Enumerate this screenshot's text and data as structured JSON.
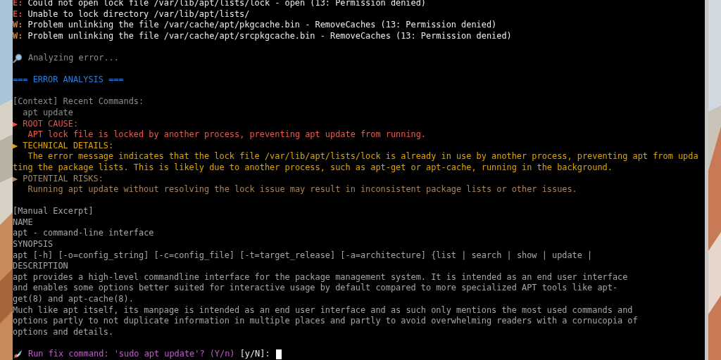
{
  "terminal": {
    "lines": [
      {
        "kind": "error",
        "prefix": "E:",
        "text": "Could not open lock file /var/lib/apt/lists/lock - open (13: Permission denied)"
      },
      {
        "kind": "error",
        "prefix": "E:",
        "text": "Unable to lock directory /var/lib/apt/lists/"
      },
      {
        "kind": "warning",
        "prefix": "W:",
        "text": "Problem unlinking the file /var/cache/apt/pkgcache.bin - RemoveCaches (13: Permission denied)"
      },
      {
        "kind": "warning",
        "prefix": "W:",
        "text": "Problem unlinking the file /var/cache/apt/srcpkgcache.bin - RemoveCaches (13: Permission denied)"
      },
      {
        "kind": "status",
        "text": "Analyzing error...",
        "space_before": true
      },
      {
        "kind": "heading",
        "text": "=== ERROR ANALYSIS ===",
        "space_before": true
      },
      {
        "kind": "note",
        "text": "[Context] Recent Commands:",
        "space_before": true
      },
      {
        "kind": "command",
        "text": "apt update"
      },
      {
        "kind": "cause",
        "prefix": "▶",
        "text": "ROOT CAUSE:"
      },
      {
        "kind": "cause_detail",
        "text": "APT lock file is locked by another process, preventing apt update from running."
      },
      {
        "kind": "tech",
        "prefix": "▶",
        "text": "TECHNICAL DETAILS:"
      },
      {
        "kind": "tech_detail",
        "text": "The error message indicates that the lock file /var/lib/apt/lists/lock is already in use by another process, preventing apt from upda"
      },
      {
        "kind": "tech_wrap",
        "text": "ting the package lists. This is likely due to another process, such as apt-get or apt-cache, running in the background."
      },
      {
        "kind": "risk",
        "prefix": "▶",
        "text": "POTENTIAL RISKS:"
      },
      {
        "kind": "risk_detail",
        "text": "Running apt update without resolving the lock issue may result in inconsistent package lists or other issues."
      },
      {
        "kind": "manual",
        "text": "[Manual Excerpt]",
        "space_before": true
      },
      {
        "kind": "manual",
        "text": "NAME"
      },
      {
        "kind": "manual",
        "text": "apt - command-line interface"
      },
      {
        "kind": "manual",
        "text": "SYNOPSIS"
      },
      {
        "kind": "manual",
        "text": "apt [-h] [-o=config_string] [-c=config_file] [-t=target_release] [-a=architecture] {list | search | show | update |"
      },
      {
        "kind": "manual",
        "text": "DESCRIPTION"
      },
      {
        "kind": "manual",
        "text": "apt provides a high-level commandline interface for the package management system. It is intended as an end user interface"
      },
      {
        "kind": "manual",
        "text": "and enables some options better suited for interactive usage by default compared to more specialized APT tools like apt-"
      },
      {
        "kind": "manual",
        "text": "get(8) and apt-cache(8)."
      },
      {
        "kind": "manual",
        "text": "Much like apt itself, its manpage is intended as an end user interface and as such only mentions the most used commands and"
      },
      {
        "kind": "manual",
        "text": "options partly to not duplicate information in multiple places and partly to avoid overwhelming readers with a cornucopia of"
      },
      {
        "kind": "manual",
        "text": "options and details."
      }
    ],
    "prompt": {
      "text": "Run fix command: 'sudo apt update'? (Y/n)",
      "choice": "[y/N]:",
      "space_before": true
    }
  }
}
